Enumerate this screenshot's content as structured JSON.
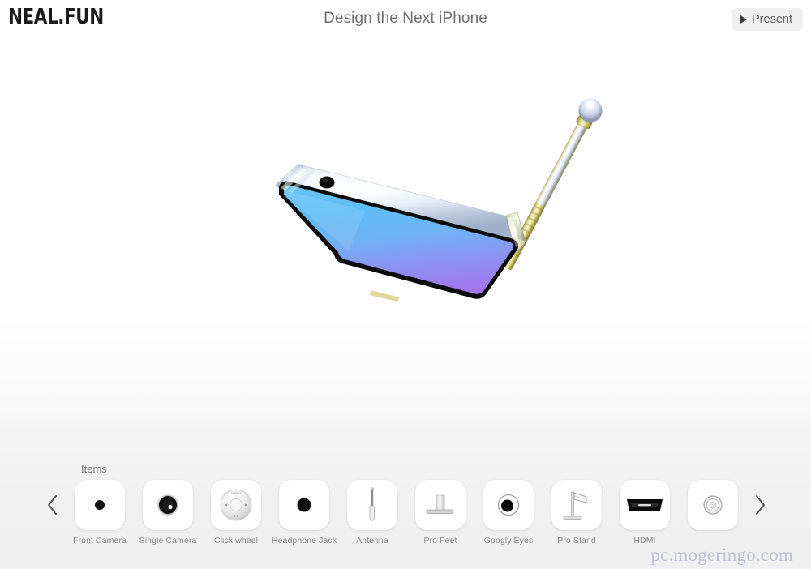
{
  "header": {
    "brand": "NEAL.FUN",
    "title": "Design the Next iPhone",
    "present_label": "Present",
    "present_icon": "play-triangle-icon"
  },
  "stage": {
    "phone": {
      "screen_gradient_top": "#5fc0f6",
      "screen_gradient_mid": "#7aa8f4",
      "screen_gradient_bottom": "#9b7cf0",
      "frame_color": "#e8eef6",
      "bezel_color": "#0d0d0d",
      "front_camera": "visible",
      "antenna": "attached-top-right",
      "antenna_tip_color": "#d8dfee",
      "antenna_shaft_color": "#d9d18a"
    }
  },
  "tray": {
    "label": "Items",
    "prev_icon": "chevron-left-icon",
    "next_icon": "chevron-right-icon",
    "items": [
      {
        "label": "Front Camera",
        "icon": "front-camera-icon"
      },
      {
        "label": "Single Camera",
        "icon": "single-camera-icon"
      },
      {
        "label": "Click wheel",
        "icon": "click-wheel-icon"
      },
      {
        "label": "Headphone Jack",
        "icon": "headphone-jack-icon"
      },
      {
        "label": "Antenna",
        "icon": "antenna-icon"
      },
      {
        "label": "Pro Feet",
        "icon": "pro-feet-icon"
      },
      {
        "label": "Googly Eyes",
        "icon": "googly-eyes-icon"
      },
      {
        "label": "Pro Stand",
        "icon": "pro-stand-icon"
      },
      {
        "label": "HDMI",
        "icon": "hdmi-icon"
      },
      {
        "label": "",
        "icon": "ring-lens-icon"
      }
    ],
    "click_wheel_text": {
      "menu": "MENU"
    }
  },
  "watermark": "pc.mogeringo.com"
}
